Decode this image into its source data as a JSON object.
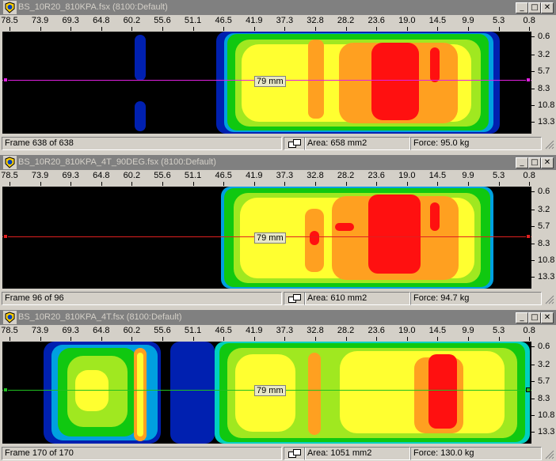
{
  "x_ticks": [
    "78.5",
    "73.9",
    "69.3",
    "64.8",
    "60.2",
    "55.6",
    "51.1",
    "46.5",
    "41.9",
    "37.3",
    "32.8",
    "28.2",
    "23.6",
    "19.0",
    "14.5",
    "9.9",
    "5.3",
    "0.8"
  ],
  "y_ticks": [
    "0.6",
    "3.2",
    "5.7",
    "8.3",
    "10.8",
    "13.3"
  ],
  "window_controls": {
    "minimize": "_",
    "maximize": "□",
    "close": "✕"
  },
  "windows": [
    {
      "title": "BS_10R20_810KPA.fsx (8100:Default)",
      "line_color": "#e020e0",
      "measure_label": "79 mm",
      "status": {
        "frame": "Frame 638 of 638",
        "area": "Area: 658 mm2",
        "force": "Force: 95.0 kg"
      }
    },
    {
      "title": "BS_10R20_810KPA_4T_90DEG.fsx (8100:Default)",
      "line_color": "#e02020",
      "measure_label": "79 mm",
      "status": {
        "frame": "Frame 96 of 96",
        "area": "Area: 610 mm2",
        "force": "Force: 94.7 kg"
      }
    },
    {
      "title": "BS_10R20_810KPA_4T.fsx (8100:Default)",
      "line_color": "#20c020",
      "measure_label": "79 mm",
      "status": {
        "frame": "Frame 170 of 170",
        "area": "Area: 1051 mm2",
        "force": "Force: 130.0 kg"
      }
    }
  ],
  "pressure_colors": {
    "blue": "#0020b0",
    "light_blue": "#00a0e0",
    "cyan": "#00d0c0",
    "green": "#10c810",
    "yellow_green": "#a0e820",
    "yellow": "#ffff30",
    "orange": "#ffa020",
    "red": "#ff1010",
    "background": "#000000"
  }
}
